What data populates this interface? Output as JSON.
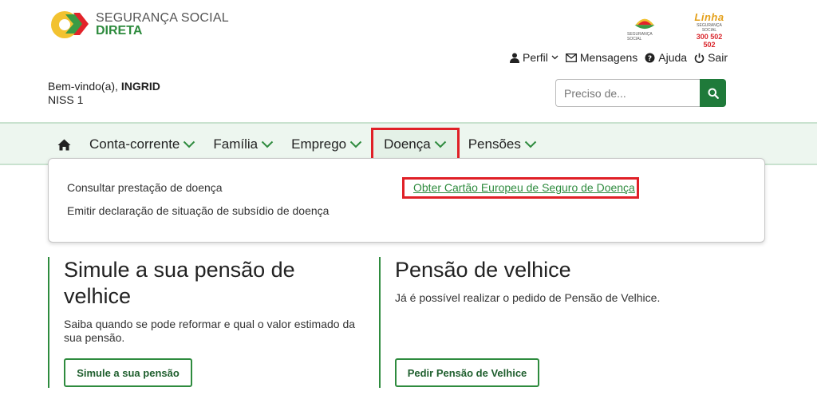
{
  "header": {
    "logo_line1": "SEGURANÇA SOCIAL",
    "logo_line2": "DIRETA",
    "emblem_caption": "SEGURANÇA SOCIAL",
    "linha_word": "Linha",
    "linha_caption": "SEGURANÇA SOCIAL",
    "linha_number": "300 502 502"
  },
  "user_menu": {
    "profile": "Perfil",
    "messages": "Mensagens",
    "help": "Ajuda",
    "logout": "Sair"
  },
  "welcome": {
    "greeting": "Bem-vindo(a),",
    "name": "INGRID",
    "niss_label": "NISS 1"
  },
  "search": {
    "placeholder": "Preciso de..."
  },
  "nav": {
    "items": [
      {
        "label": "Conta-corrente"
      },
      {
        "label": "Família"
      },
      {
        "label": "Emprego"
      },
      {
        "label": "Doença"
      },
      {
        "label": "Pensões"
      }
    ]
  },
  "dropdown": {
    "left_links": [
      "Consultar prestação de doença",
      "Emitir declaração de situação de subsídio de doença"
    ],
    "right_links": [
      "Obter Cartão Europeu de Seguro de Doença"
    ]
  },
  "cards": [
    {
      "title": "Simule a sua pensão de velhice",
      "text": "Saiba quando se pode reformar e qual o valor estimado da sua pensão.",
      "button": "Simule a sua pensão"
    },
    {
      "title": "Pensão de velhice",
      "text": "Já é possível realizar o pedido de Pensão de Velhice.",
      "button": "Pedir Pensão de Velhice"
    }
  ],
  "colors": {
    "brand_green": "#2e8b3e",
    "highlight_red": "#e02027",
    "nav_bg": "#edf6ef"
  }
}
